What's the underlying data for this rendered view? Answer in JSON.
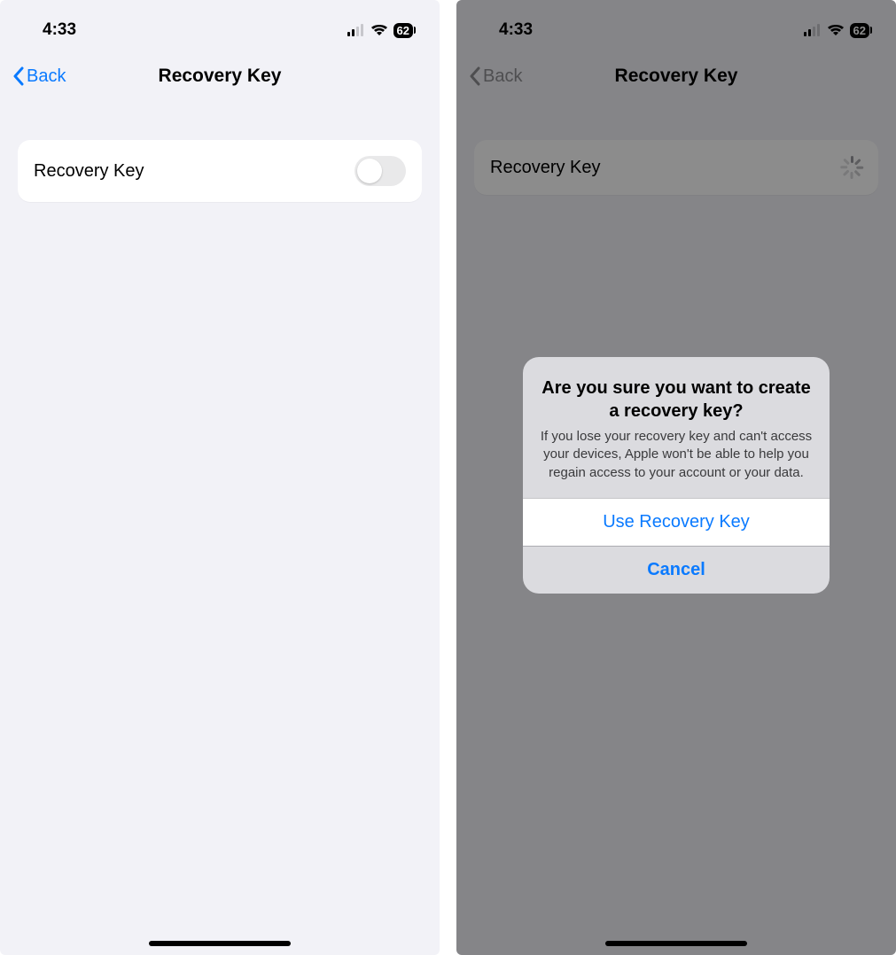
{
  "status": {
    "time": "4:33",
    "battery": "62"
  },
  "nav": {
    "back_label": "Back",
    "title": "Recovery Key"
  },
  "row": {
    "label": "Recovery Key"
  },
  "alert": {
    "title": "Are you sure you want to create a recovery key?",
    "message": "If you lose your recovery key and can't access your devices, Apple won't be able to help you regain access to your account or your data.",
    "confirm": "Use Recovery Key",
    "cancel": "Cancel"
  }
}
